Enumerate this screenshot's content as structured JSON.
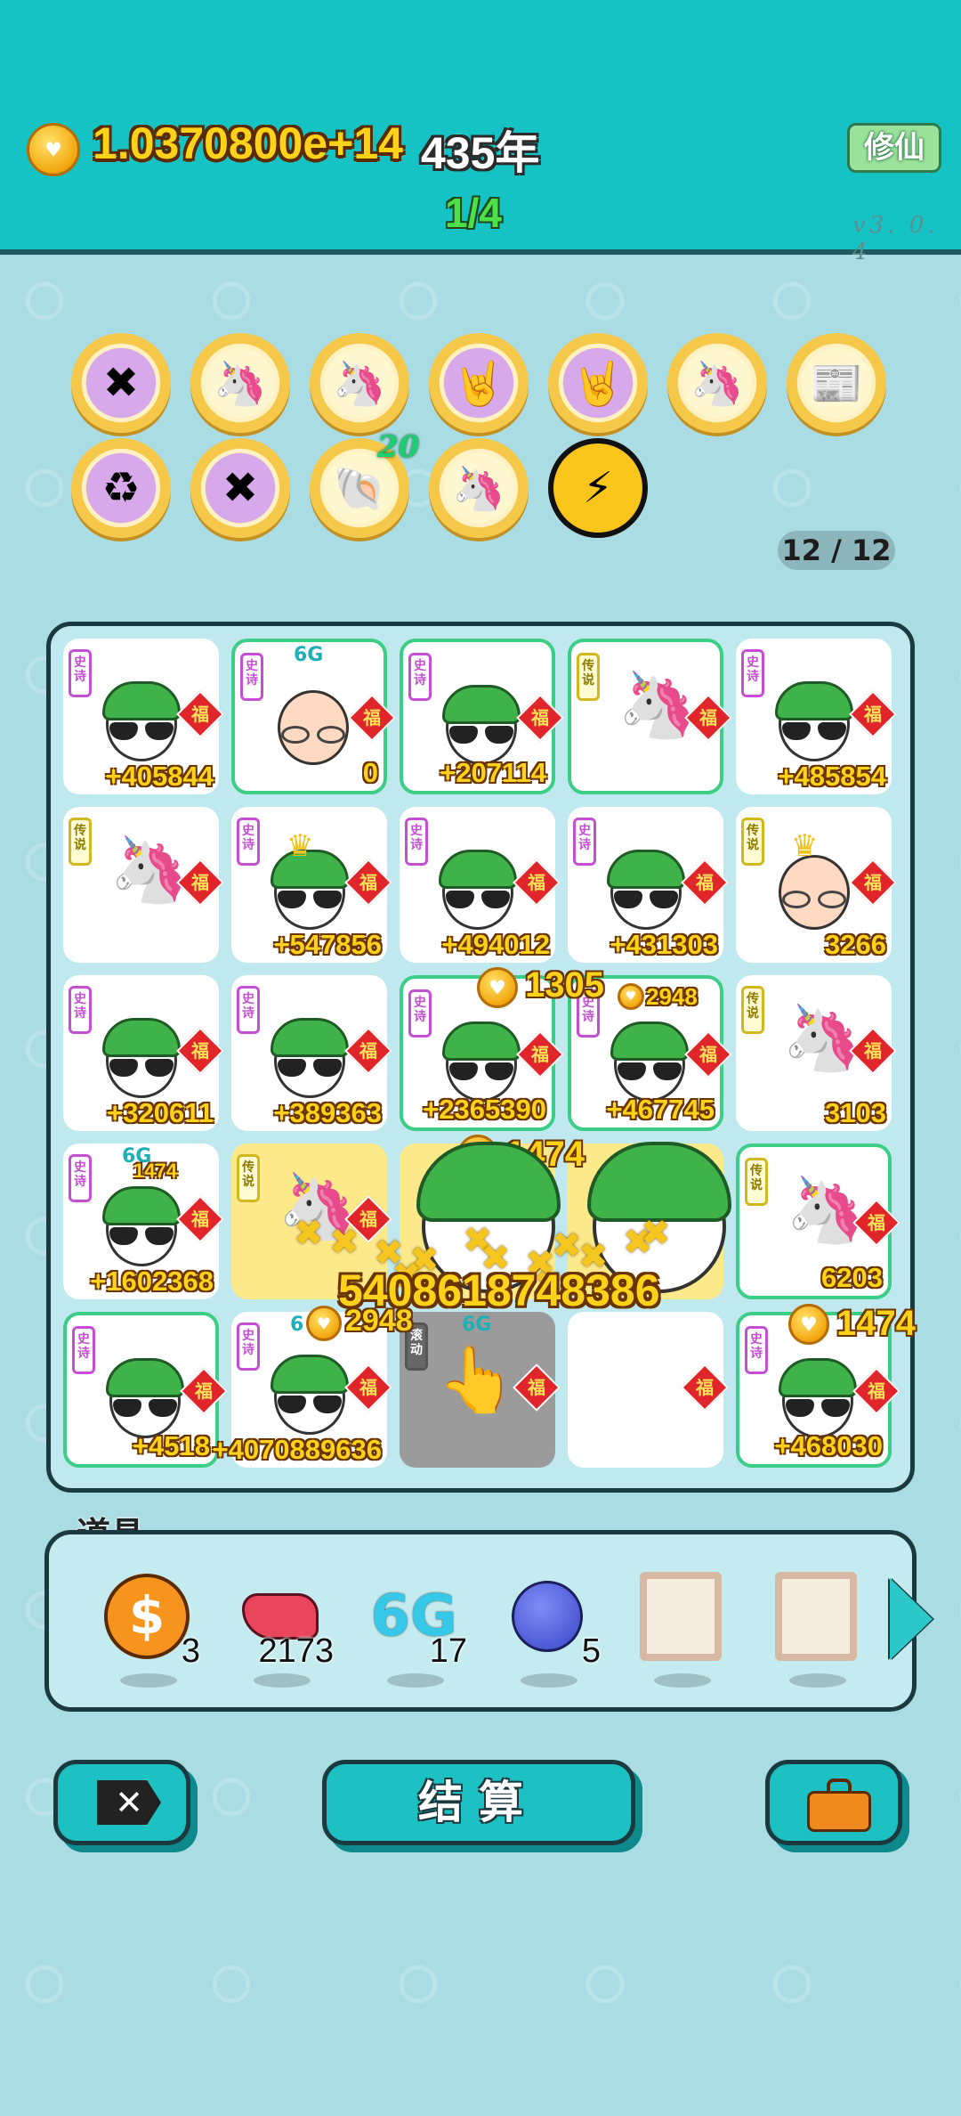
{
  "header": {
    "money": "1.0370800e+14",
    "year": "435年",
    "round": "1/4",
    "xiuxian_label": "修仙",
    "version": "v3. 0. 4"
  },
  "relics": {
    "items": [
      {
        "icon": "multiply-dice-icon"
      },
      {
        "icon": "unicorn-icon"
      },
      {
        "icon": "unicorn-icon"
      },
      {
        "icon": "rock-hand-icon"
      },
      {
        "icon": "rock-hand-icon"
      },
      {
        "icon": "unicorn-icon"
      },
      {
        "icon": "time-magazine-icon"
      },
      {
        "icon": "recycle-icon"
      },
      {
        "icon": "multiply-dice-icon"
      },
      {
        "icon": "shell-icon"
      },
      {
        "icon": "unicorn-icon"
      },
      {
        "icon": "lightning-icon"
      }
    ],
    "badge": "20",
    "count": "12 / 12"
  },
  "board": {
    "rows": [
      [
        {
          "type": "guy",
          "tag": "史诗",
          "value": "+405844",
          "border": false
        },
        {
          "type": "bald",
          "tag": "史诗",
          "value": "0",
          "border": true,
          "six": "6G"
        },
        {
          "type": "guy",
          "tag": "史诗",
          "value": "+207114",
          "border": true
        },
        {
          "type": "unicorn",
          "tag": "传说",
          "value": "",
          "border": true
        },
        {
          "type": "guy",
          "tag": "史诗",
          "value": "+485854",
          "border": false
        }
      ],
      [
        {
          "type": "unicorn",
          "tag": "传说",
          "value": "",
          "border": false
        },
        {
          "type": "guy",
          "tag": "史诗",
          "value": "+547856",
          "border": false,
          "crown": true
        },
        {
          "type": "guy",
          "tag": "史诗",
          "value": "+494012",
          "border": false
        },
        {
          "type": "guy",
          "tag": "史诗",
          "value": "+431303",
          "border": false
        },
        {
          "type": "bald",
          "tag": "传说",
          "value": "3266",
          "border": false,
          "crown": true
        }
      ],
      [
        {
          "type": "guy",
          "tag": "史诗",
          "value": "+320611",
          "border": false
        },
        {
          "type": "guy",
          "tag": "史诗",
          "value": "+389363",
          "border": false
        },
        {
          "type": "guy",
          "tag": "史诗",
          "value": "+2365390",
          "border": true
        },
        {
          "type": "guy",
          "tag": "史诗",
          "value": "+467745",
          "border": true
        },
        {
          "type": "unicorn",
          "tag": "传说",
          "value": "3103",
          "border": false
        }
      ],
      [
        {
          "type": "guy",
          "tag": "史诗",
          "value": "+1602368",
          "border": false,
          "six": "6G"
        },
        {
          "type": "unicorn",
          "tag": "传说",
          "value": "",
          "border": false,
          "yellow": true
        },
        {
          "type": "empty",
          "tag": "",
          "value": "",
          "border": false,
          "yellow": true
        },
        {
          "type": "empty",
          "tag": "",
          "value": "",
          "border": false,
          "yellow": true
        },
        {
          "type": "unicorn",
          "tag": "传说",
          "value": "6203",
          "border": true
        }
      ],
      [
        {
          "type": "guy",
          "tag": "史诗",
          "value": "+4518",
          "border": true
        },
        {
          "type": "guy",
          "tag": "史诗",
          "value": "+4070889636",
          "border": false,
          "six": "6"
        },
        {
          "type": "hand",
          "tag": "滚动",
          "value": "",
          "border": false,
          "gray": true,
          "six": "6G"
        },
        {
          "type": "blank",
          "tag": "",
          "value": "",
          "border": false
        },
        {
          "type": "guy",
          "tag": "史诗",
          "value": "+468030",
          "border": true
        }
      ]
    ],
    "fu_label": "福",
    "floats": {
      "f1": "1305",
      "f2": "2948",
      "f3": "1474",
      "f4": "2948",
      "f5": "1474",
      "f6": "1474",
      "big": "5408618748386"
    }
  },
  "tools": {
    "label": "道具",
    "items": [
      {
        "icon": "dollar-coin-icon",
        "count": "3"
      },
      {
        "icon": "liver-icon",
        "count": "2173"
      },
      {
        "icon": "6g-icon",
        "count": "17",
        "text": "6G"
      },
      {
        "icon": "blueberry-icon",
        "count": "5"
      },
      {
        "icon": "empty-frame-icon",
        "count": ""
      },
      {
        "icon": "empty-frame-icon",
        "count": ""
      }
    ]
  },
  "buttons": {
    "close_icon": "✕",
    "settle_label": "结算"
  },
  "colors": {
    "accent": "#15c3c5",
    "background": "#a9dde3",
    "gold_text": "#ffd21a",
    "epic_tag": "#c44fd2",
    "legend_tag": "#d2b820"
  }
}
